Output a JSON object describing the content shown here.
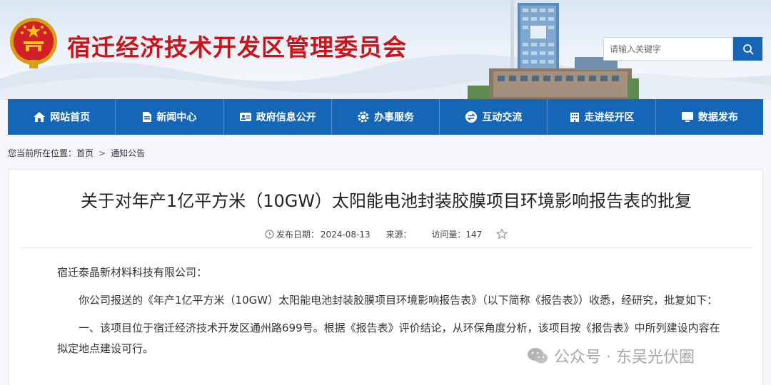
{
  "header": {
    "site_title": "宿迁经济技术开发区管理委员会",
    "search_placeholder": "请输入关键字"
  },
  "nav": {
    "items": [
      {
        "label": "网站首页",
        "icon": "home-icon"
      },
      {
        "label": "新闻中心",
        "icon": "document-icon"
      },
      {
        "label": "政府信息公开",
        "icon": "id-card-icon"
      },
      {
        "label": "办事服务",
        "icon": "gear-icon"
      },
      {
        "label": "互动交流",
        "icon": "exchange-icon"
      },
      {
        "label": "走进经开区",
        "icon": "building-icon"
      },
      {
        "label": "数据发布",
        "icon": "monitor-icon"
      }
    ]
  },
  "breadcrumb": {
    "prefix": "您当前所在位置：",
    "home": "首页",
    "separator": ">",
    "current": "通知公告"
  },
  "article": {
    "title": "关于对年产1亿平方米（10GW）太阳能电池封装胶膜项目环境影响报告表的批复",
    "publish_label": "发布日期：",
    "publish_date": "2024-08-13",
    "source_label": "来源：",
    "views_label": "访问量：",
    "views": "147",
    "salutation": "宿迁泰晶新材料科技有限公司：",
    "paragraph1": "你公司报送的《年产1亿平方米（10GW）太阳能电池封装胶膜项目环境影响报告表》（以下简称《报告表》）收悉，经研究，批复如下：",
    "paragraph2": "一、该项目位于宿迁经济技术开发区通州路699号。根据《报告表》评价结论，从环保角度分析，该项目按《报告表》中所列建设内容在拟定地点建设可行。"
  },
  "watermark": {
    "text": "公众号 · 东吴光伏圈"
  },
  "colors": {
    "brand_blue": "#1666b8",
    "title_red": "#c8141b"
  }
}
